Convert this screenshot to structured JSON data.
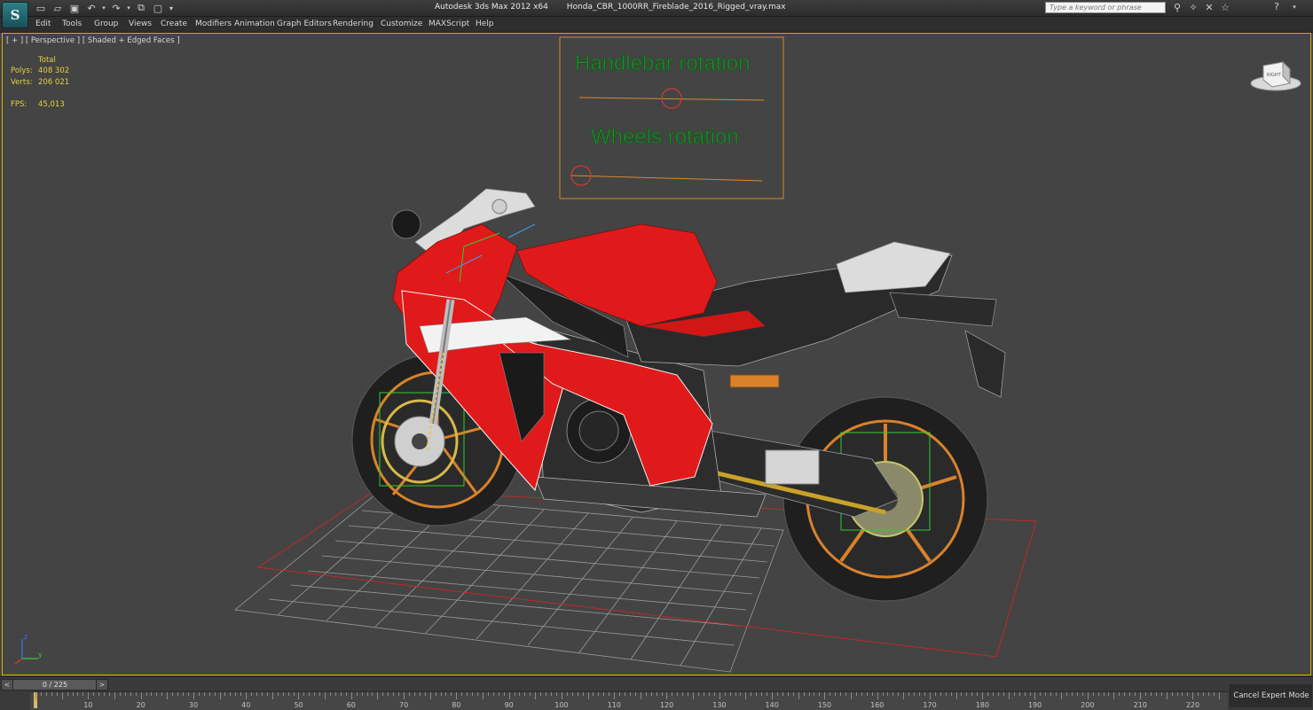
{
  "titlebar": {
    "app_title": "Autodesk 3ds Max  2012 x64",
    "file_name": "Honda_CBR_1000RR_Fireblade_2016_Rigged_vray.max",
    "search_placeholder": "Type a keyword or phrase",
    "logo_glyph": "S"
  },
  "quick_access": {
    "icons": [
      "new-file-icon",
      "open-file-icon",
      "save-icon",
      "undo-icon",
      "undo-dropdown-icon",
      "redo-icon",
      "redo-dropdown-icon",
      "hold-icon",
      "project-folder-icon",
      "dropdown-icon"
    ]
  },
  "menu": {
    "items": [
      "Edit",
      "Tools",
      "Group",
      "Views",
      "Create",
      "Modifiers",
      "Animation",
      "Graph Editors",
      "Rendering",
      "Customize",
      "MAXScript",
      "Help"
    ]
  },
  "viewport": {
    "label": "[ + ] [ Perspective ] [ Shaded + Edged Faces ]",
    "stats": {
      "total_label": "Total",
      "polys_label": "Polys:",
      "polys_value": "408 302",
      "verts_label": "Verts:",
      "verts_value": "206 021",
      "fps_label": "FPS:",
      "fps_value": "45,013"
    },
    "rig_panel": {
      "handlebar_label": "Handlebar rotation",
      "wheels_label": "Wheels rotation"
    },
    "viewcube_label": "RIGHT",
    "axis": {
      "z": "z",
      "y": "y"
    },
    "colors": {
      "frame_border": "#d8b200",
      "rig_text": "#1f8a2a",
      "rig_frame": "#d98a2a",
      "slider_knob": "#d33b2a",
      "bike_red": "#e01a1a",
      "wheel_orange": "#d9822b",
      "grid_line": "#9a9a9a",
      "grid_boundary": "#c0282b"
    }
  },
  "timeline": {
    "frame_display": "0 / 225",
    "prev_arrow": "<",
    "next_arrow": ">",
    "ticks": [
      "0",
      "10",
      "20",
      "30",
      "40",
      "50",
      "60",
      "70",
      "80",
      "90",
      "100",
      "110",
      "120",
      "130",
      "140",
      "150",
      "160",
      "170",
      "180",
      "190",
      "200",
      "210",
      "220"
    ],
    "cancel_expert_mode": "Cancel Expert Mode"
  }
}
